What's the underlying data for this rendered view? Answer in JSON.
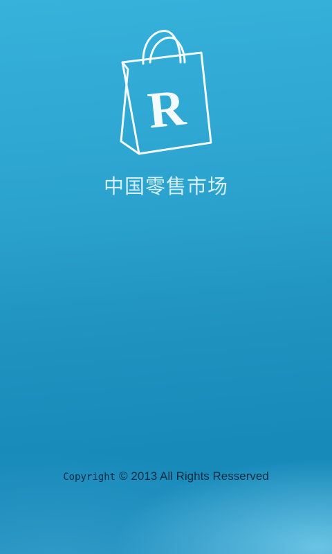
{
  "app": {
    "name": "中国零售市场",
    "logo_letter": "R",
    "logo_icon": "shopping-bag-icon"
  },
  "footer": {
    "copyright_word": "Copyright",
    "copyright_rest": "© 2013 All Rights Resserved"
  },
  "colors": {
    "background_top": "#36b2db",
    "background_bottom": "#178aba",
    "logo_stroke": "#f4fbfe",
    "app_name_text": "#d5eef8",
    "footer_text": "#0d2a3e"
  }
}
